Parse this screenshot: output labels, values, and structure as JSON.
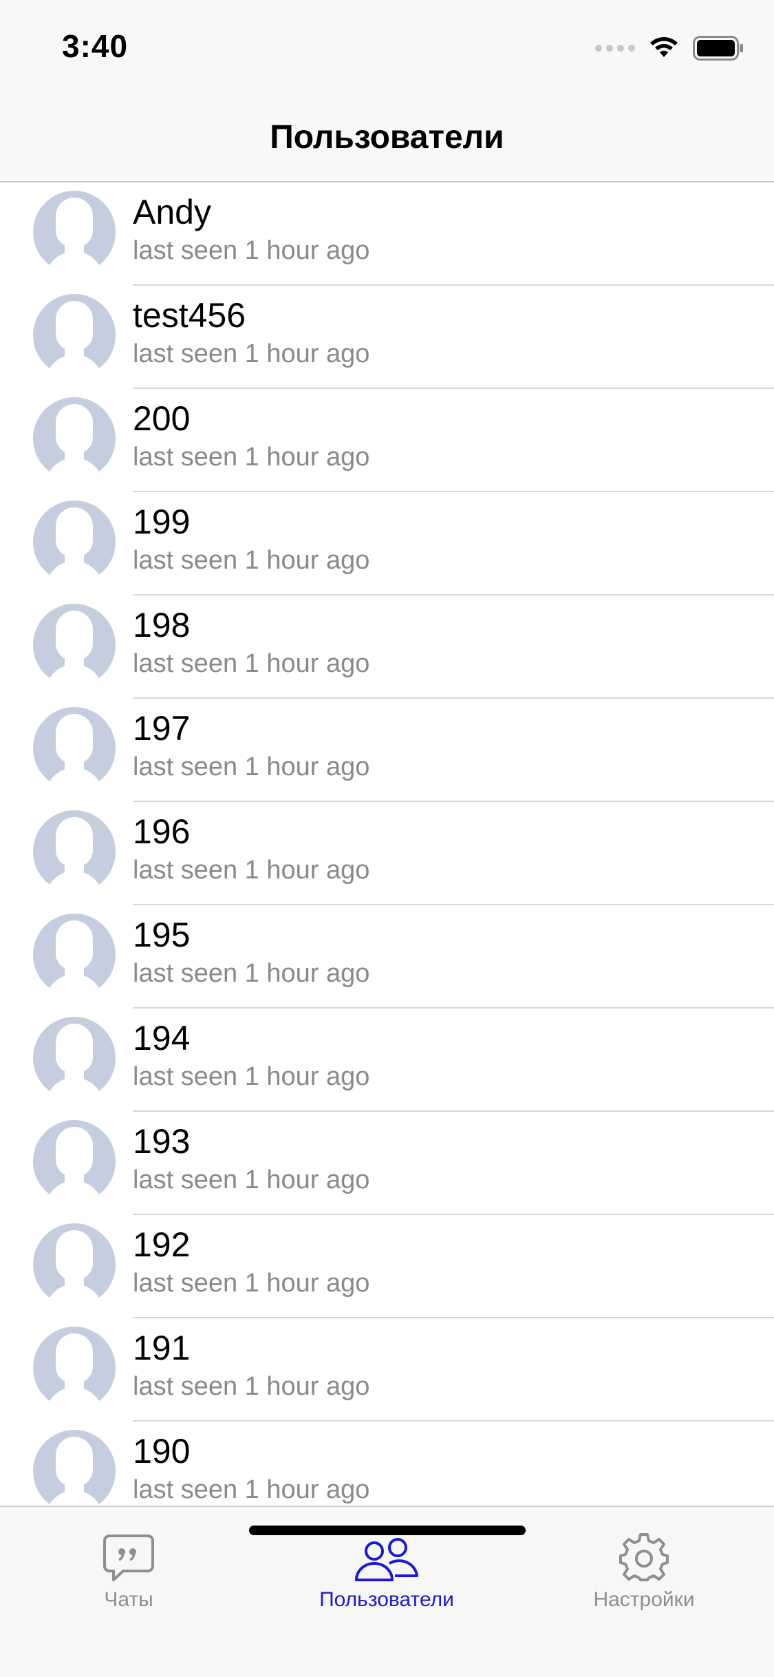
{
  "status_bar": {
    "time": "3:40"
  },
  "nav": {
    "title": "Пользователи"
  },
  "users": [
    {
      "name": "Andy",
      "status": "last seen 1 hour ago"
    },
    {
      "name": "test456",
      "status": "last seen 1 hour ago"
    },
    {
      "name": "200",
      "status": "last seen 1 hour ago"
    },
    {
      "name": "199",
      "status": "last seen 1 hour ago"
    },
    {
      "name": "198",
      "status": "last seen 1 hour ago"
    },
    {
      "name": "197",
      "status": "last seen 1 hour ago"
    },
    {
      "name": "196",
      "status": "last seen 1 hour ago"
    },
    {
      "name": "195",
      "status": "last seen 1 hour ago"
    },
    {
      "name": "194",
      "status": "last seen 1 hour ago"
    },
    {
      "name": "193",
      "status": "last seen 1 hour ago"
    },
    {
      "name": "192",
      "status": "last seen 1 hour ago"
    },
    {
      "name": "191",
      "status": "last seen 1 hour ago"
    },
    {
      "name": "190",
      "status": "last seen 1 hour ago"
    }
  ],
  "tabs": [
    {
      "label": "Чаты",
      "icon": "chat-bubble-icon",
      "active": false
    },
    {
      "label": "Пользователи",
      "icon": "users-icon",
      "active": true
    },
    {
      "label": "Настройки",
      "icon": "gear-icon",
      "active": false
    }
  ],
  "colors": {
    "accent": "#1a1ad6",
    "inactive": "#8e8e93",
    "avatar_placeholder": "#c5cede",
    "secondary_text": "#8a8a8e"
  }
}
